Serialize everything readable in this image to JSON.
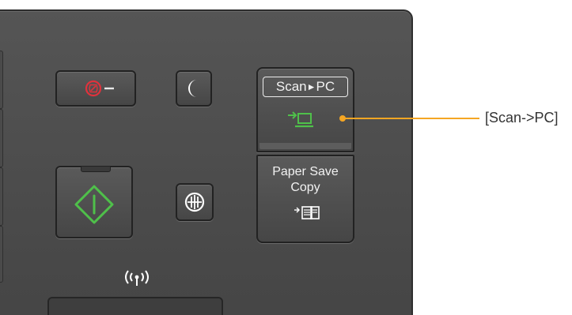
{
  "panel": {
    "buttons": {
      "stop": {
        "icon": "stop-icon"
      },
      "energy_saver": {
        "icon": "moon-icon"
      },
      "start": {
        "icon": "start-diamond-icon"
      },
      "language": {
        "icon": "language-icon"
      },
      "scan_to_pc": {
        "label_left": "Scan",
        "label_arrow": "►",
        "label_right": "PC",
        "icon": "scan-to-pc-icon"
      },
      "paper_save_copy": {
        "line1": "Paper Save",
        "line2": "Copy",
        "icon": "paper-save-copy-icon"
      }
    },
    "wifi": {
      "icon": "wireless-icon"
    },
    "indicator_color": "#f5a623"
  },
  "callout": {
    "label": "[Scan->PC]"
  },
  "colors": {
    "panel": "#4d4d4d",
    "stop_red": "#e0323c",
    "start_green": "#4fc04a",
    "accent_orange": "#f5a623",
    "label_text": "#333333"
  }
}
